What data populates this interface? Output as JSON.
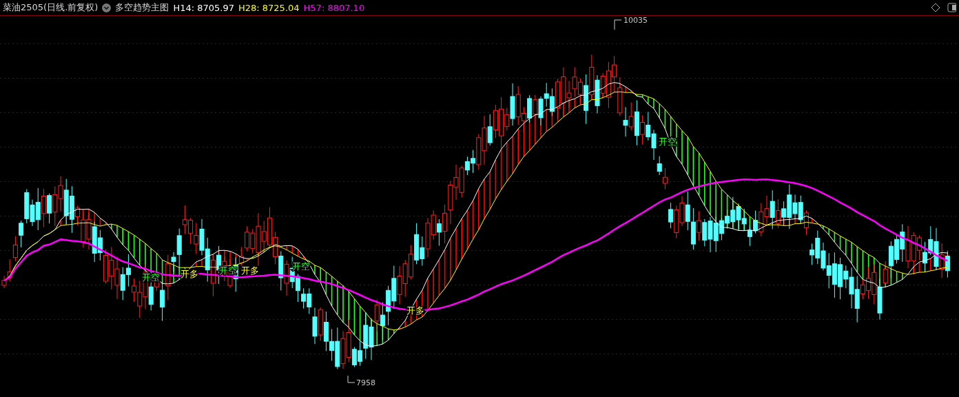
{
  "header": {
    "instrument": "菜油2505(日线.前复权)",
    "indicator": "多空趋势主图",
    "readings": [
      {
        "text": "H14: 8705.97",
        "color": "#ffffff"
      },
      {
        "text": "H28: 8725.04",
        "color": "#ffff00"
      },
      {
        "text": "H57: 8807.10",
        "color": "#ff00ff"
      }
    ]
  },
  "chart": {
    "high_label": "10035",
    "low_label": "7958",
    "signals": [
      {
        "text": "开空",
        "kind": "short"
      },
      {
        "text": "开多",
        "kind": "long"
      },
      {
        "text": "开空",
        "kind": "short"
      },
      {
        "text": "开多",
        "kind": "long"
      },
      {
        "text": "开空",
        "kind": "short"
      },
      {
        "text": "开多",
        "kind": "long"
      },
      {
        "text": "开空",
        "kind": "short"
      }
    ]
  }
}
